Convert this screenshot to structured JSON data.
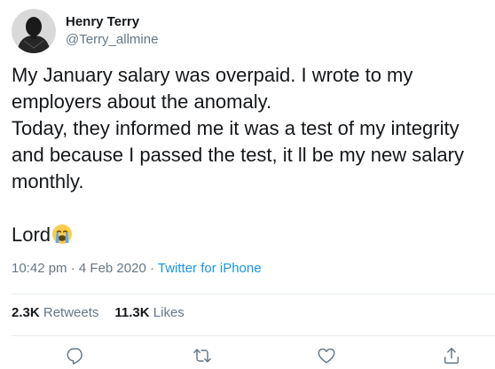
{
  "author": {
    "display_name": "Henry Terry",
    "handle": "@Terry_allmine"
  },
  "tweet": {
    "lines": [
      "My January salary was overpaid. I wrote to my",
      "employers about the anomaly.",
      "Today, they informed me it was a test of my integrity",
      "and because I passed the test, it ll be my new salary",
      "monthly."
    ],
    "last_line": "Lord",
    "emoji": "loudly-crying-face-emoji"
  },
  "meta": {
    "time": "10:42 pm",
    "separator": " · ",
    "date": "4 Feb 2020",
    "separator2": " · ",
    "source": "Twitter for iPhone"
  },
  "stats": {
    "retweets_count": "2.3K",
    "retweets_label": "Retweets",
    "likes_count": "11.3K",
    "likes_label": "Likes"
  },
  "actions": {
    "reply_icon": "reply-icon",
    "retweet_icon": "retweet-icon",
    "like_icon": "like-icon",
    "share_icon": "share-icon"
  },
  "colors": {
    "text": "#14171a",
    "secondary": "#657786",
    "link": "#1b95e0",
    "divider": "#e6ecf0"
  }
}
